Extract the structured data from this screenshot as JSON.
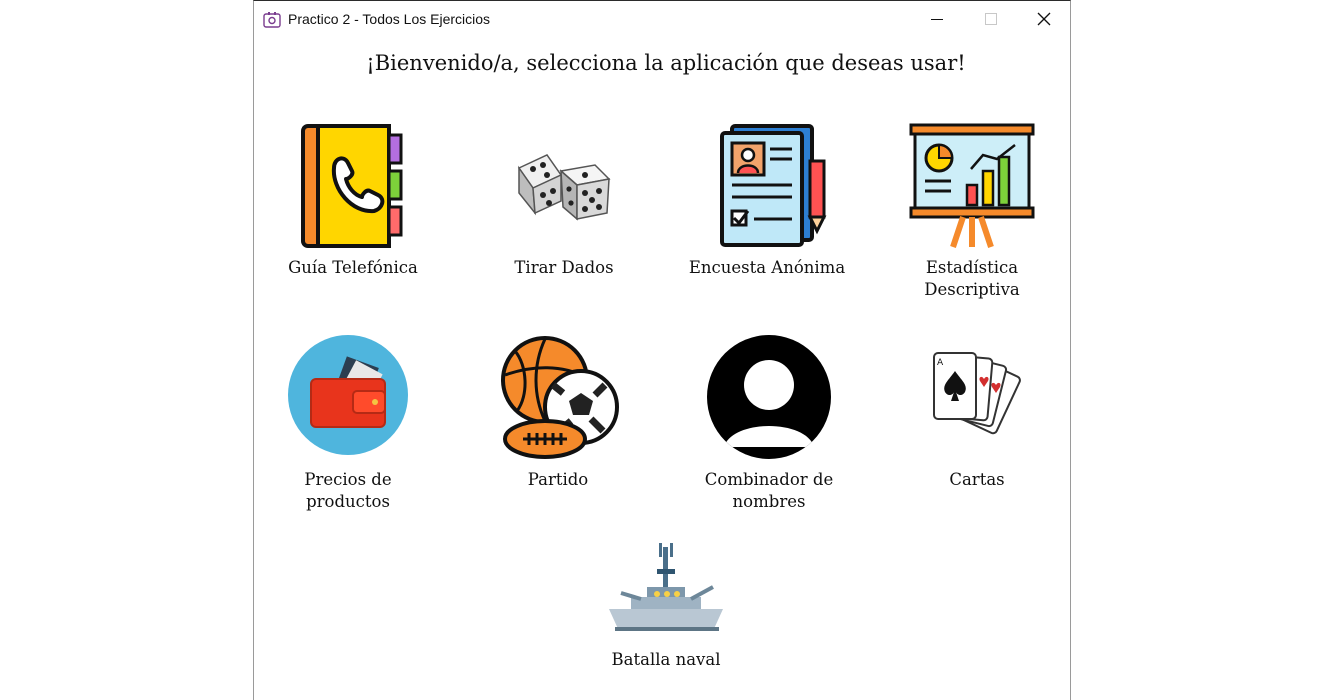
{
  "window": {
    "title": "Practico 2 - Todos Los Ejercicios",
    "controls": {
      "minimize": "minimize-icon",
      "maximize": "maximize-icon",
      "close": "close-icon"
    }
  },
  "heading": "¡Bienvenido/a, selecciona la aplicación que deseas usar!",
  "apps": [
    {
      "label": "Guía Telefónica",
      "icon": "phone-book-icon"
    },
    {
      "label": "Tirar Dados",
      "icon": "dice-icon"
    },
    {
      "label": "Encuesta Anónima",
      "icon": "survey-form-icon"
    },
    {
      "label": "Estadística Descriptiva",
      "icon": "statistics-board-icon"
    },
    {
      "label": "Precios de productos",
      "icon": "wallet-icon"
    },
    {
      "label": "Partido",
      "icon": "sports-balls-icon"
    },
    {
      "label": "Combinador de nombres",
      "icon": "user-avatar-icon"
    },
    {
      "label": "Cartas",
      "icon": "playing-cards-icon"
    },
    {
      "label": "Batalla naval",
      "icon": "battleship-icon"
    }
  ],
  "colors": {
    "window_border": "#2b2b2b",
    "text": "#111111",
    "wallet_circle": "#4fb5dd"
  }
}
